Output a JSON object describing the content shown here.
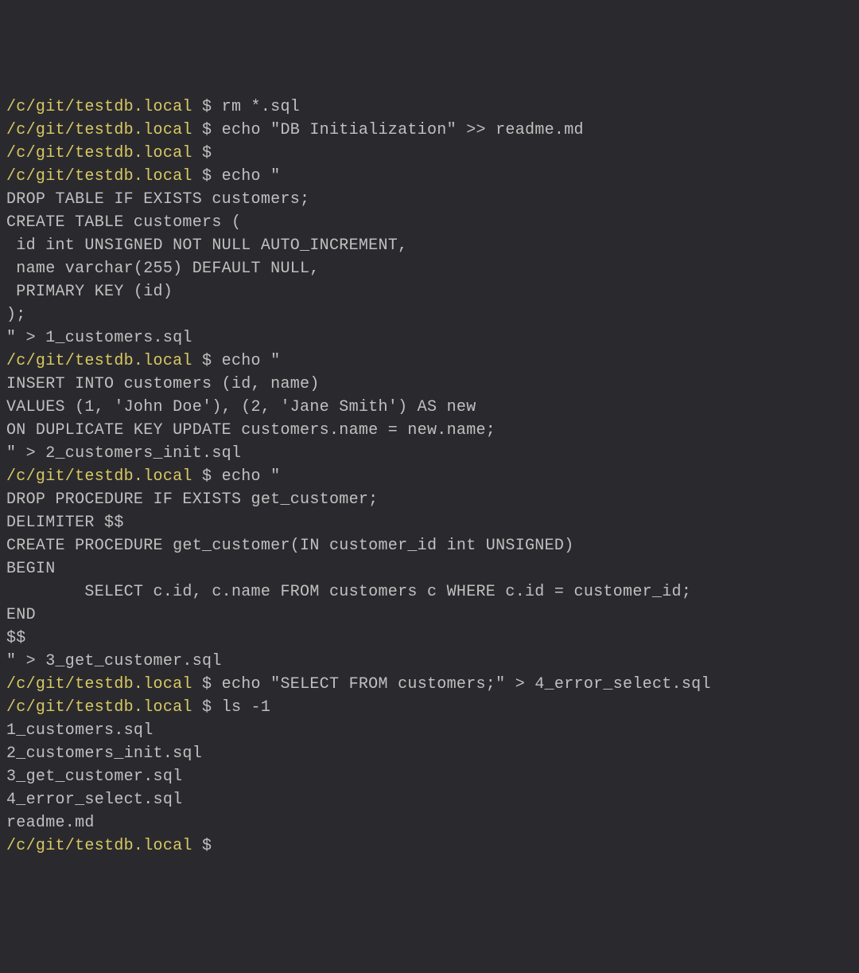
{
  "terminal": {
    "prompt_path": "/c/git/testdb.local",
    "dollar": " $ ",
    "lines": [
      {
        "type": "prompt",
        "cmd": "rm *.sql"
      },
      {
        "type": "prompt",
        "cmd": "echo \"DB Initialization\" >> readme.md"
      },
      {
        "type": "prompt",
        "cmd": ""
      },
      {
        "type": "prompt",
        "cmd": "echo \""
      },
      {
        "type": "out",
        "text": "DROP TABLE IF EXISTS customers;"
      },
      {
        "type": "out",
        "text": "CREATE TABLE customers ("
      },
      {
        "type": "out",
        "text": " id int UNSIGNED NOT NULL AUTO_INCREMENT,"
      },
      {
        "type": "out",
        "text": " name varchar(255) DEFAULT NULL,"
      },
      {
        "type": "out",
        "text": " PRIMARY KEY (id)"
      },
      {
        "type": "out",
        "text": ");"
      },
      {
        "type": "out",
        "text": "\" > 1_customers.sql"
      },
      {
        "type": "prompt",
        "cmd": "echo \""
      },
      {
        "type": "out",
        "text": "INSERT INTO customers (id, name)"
      },
      {
        "type": "out",
        "text": "VALUES (1, 'John Doe'), (2, 'Jane Smith') AS new"
      },
      {
        "type": "out",
        "text": "ON DUPLICATE KEY UPDATE customers.name = new.name;"
      },
      {
        "type": "out",
        "text": "\" > 2_customers_init.sql"
      },
      {
        "type": "prompt",
        "cmd": "echo \""
      },
      {
        "type": "out",
        "text": "DROP PROCEDURE IF EXISTS get_customer;"
      },
      {
        "type": "out",
        "text": "DELIMITER $$"
      },
      {
        "type": "out",
        "text": "CREATE PROCEDURE get_customer(IN customer_id int UNSIGNED)"
      },
      {
        "type": "out",
        "text": "BEGIN"
      },
      {
        "type": "out",
        "text": "        SELECT c.id, c.name FROM customers c WHERE c.id = customer_id;"
      },
      {
        "type": "out",
        "text": "END"
      },
      {
        "type": "out",
        "text": "$$"
      },
      {
        "type": "out",
        "text": "\" > 3_get_customer.sql"
      },
      {
        "type": "prompt",
        "cmd": "echo \"SELECT FROM customers;\" > 4_error_select.sql"
      },
      {
        "type": "prompt",
        "cmd": "ls -1"
      },
      {
        "type": "out",
        "text": "1_customers.sql"
      },
      {
        "type": "out",
        "text": "2_customers_init.sql"
      },
      {
        "type": "out",
        "text": "3_get_customer.sql"
      },
      {
        "type": "out",
        "text": "4_error_select.sql"
      },
      {
        "type": "out",
        "text": "readme.md"
      },
      {
        "type": "prompt",
        "cmd": ""
      }
    ]
  }
}
